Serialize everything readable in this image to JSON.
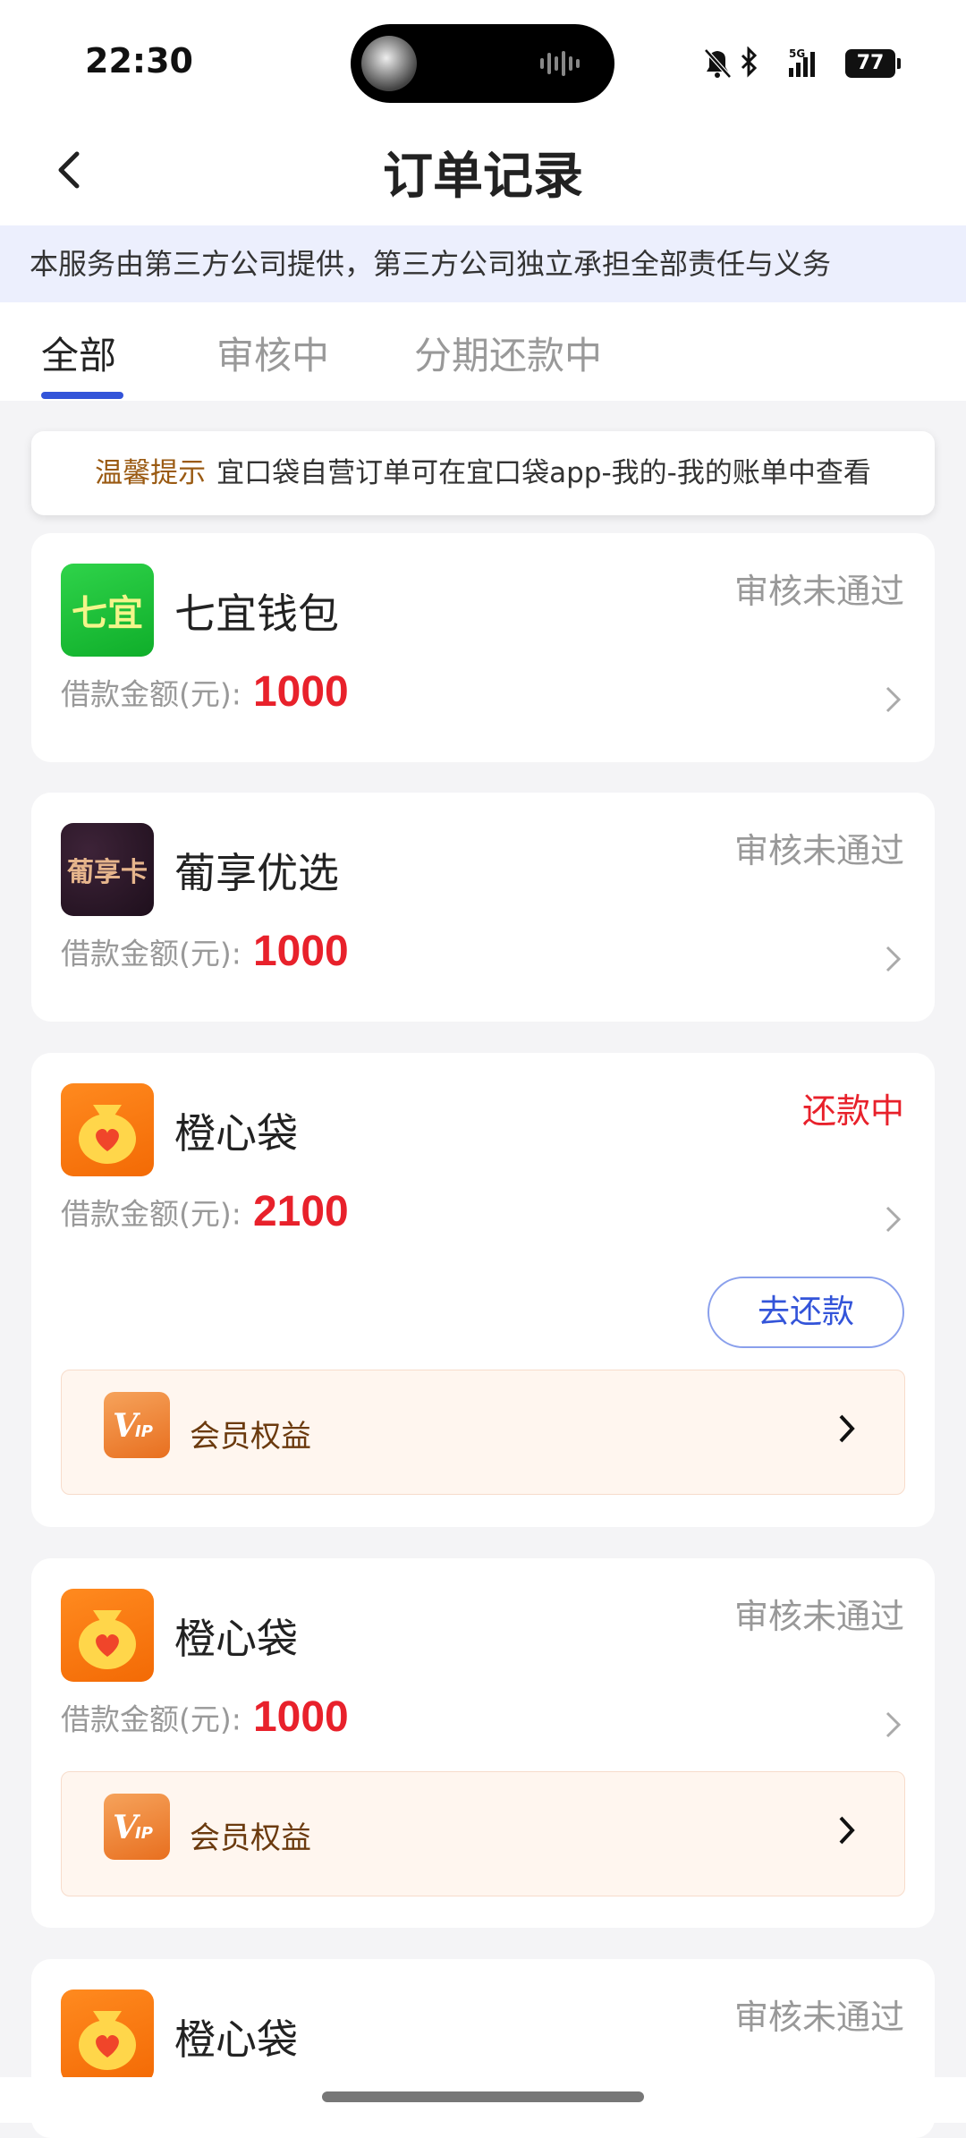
{
  "status_bar": {
    "time": "22:30",
    "battery": "77"
  },
  "nav": {
    "title": "订单记录"
  },
  "notice": "本服务由第三方公司提供，第三方公司独立承担全部责任与义务",
  "tabs": [
    {
      "label": "全部",
      "active": true
    },
    {
      "label": "审核中",
      "active": false
    },
    {
      "label": "分期还款中",
      "active": false
    }
  ],
  "tip": {
    "label": "温馨提示",
    "text": "宜口袋自营订单可在宜口袋app-我的-我的账单中查看"
  },
  "amount_label": "借款金额(元):",
  "orders": [
    {
      "name": "七宜钱包",
      "logo_text": "七宜",
      "status": "审核未通过",
      "amount": "1000"
    },
    {
      "name": "葡享优选",
      "logo_text": "葡享卡",
      "status": "审核未通过",
      "amount": "1000"
    },
    {
      "name": "橙心袋",
      "status": "还款中",
      "amount": "2100",
      "repay_button": "去还款",
      "vip_label": "会员权益"
    },
    {
      "name": "橙心袋",
      "status": "审核未通过",
      "amount": "1000",
      "vip_label": "会员权益"
    },
    {
      "name": "橙心袋",
      "status": "审核未通过"
    }
  ],
  "colors": {
    "accent": "#3354d9",
    "amount_red": "#e8212b",
    "status_gray": "#999999",
    "vip_text": "#6b3a0e"
  }
}
